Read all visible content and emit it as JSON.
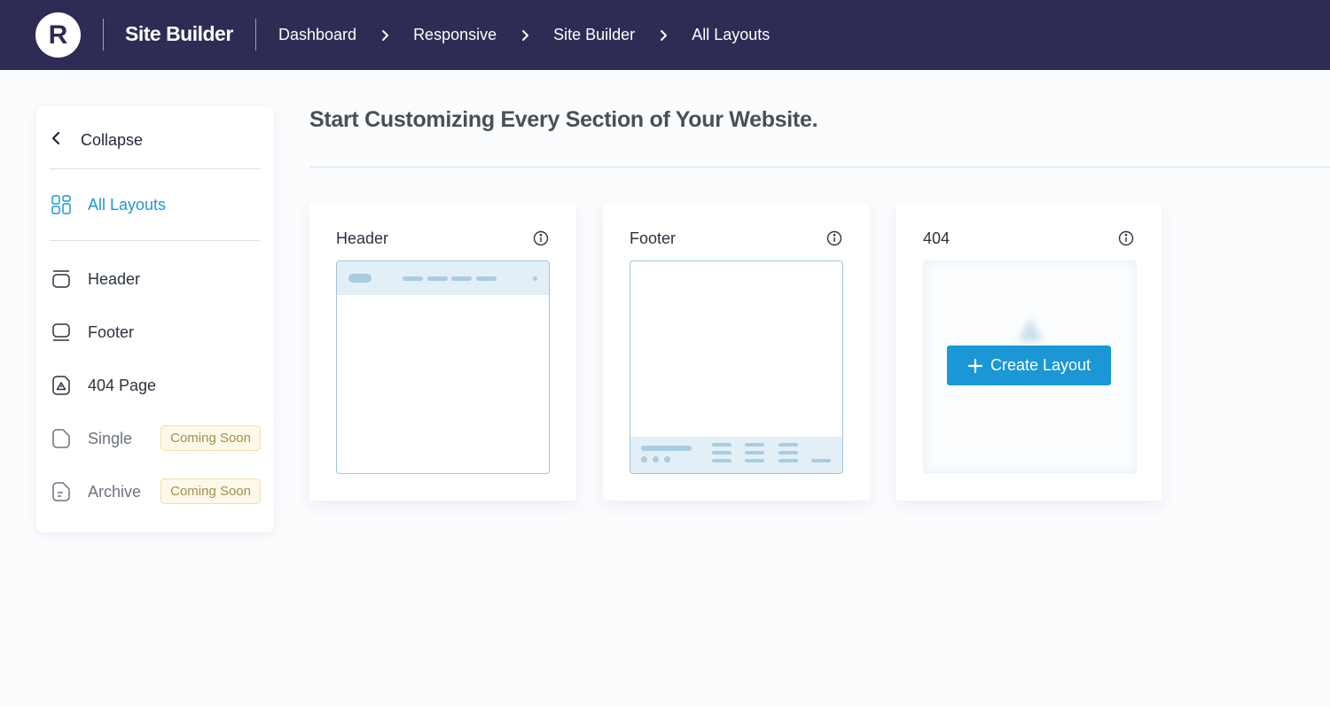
{
  "topbar": {
    "logo_letter": "R",
    "brand": "Site Builder",
    "breadcrumbs": [
      "Dashboard",
      "Responsive",
      "Site Builder",
      "All Layouts"
    ]
  },
  "sidebar": {
    "collapse_label": "Collapse",
    "items": [
      {
        "label": "All Layouts",
        "icon": "grid-icon",
        "active": true
      },
      {
        "label": "Header",
        "icon": "header-layout-icon"
      },
      {
        "label": "Footer",
        "icon": "footer-layout-icon"
      },
      {
        "label": "404 Page",
        "icon": "warning-page-icon"
      },
      {
        "label": "Single",
        "icon": "single-page-icon",
        "badge": "Coming Soon"
      },
      {
        "label": "Archive",
        "icon": "archive-page-icon",
        "badge": "Coming Soon"
      }
    ]
  },
  "main": {
    "title": "Start Customizing Every Section of Your Website.",
    "cards": [
      {
        "title": "Header"
      },
      {
        "title": "Footer"
      },
      {
        "title": "404",
        "button_label": "Create Layout"
      }
    ]
  },
  "colors": {
    "topbar_bg": "#2e2c55",
    "accent": "#1a97d4",
    "badge_text": "#a38f4a",
    "badge_bg": "#fdf9ea"
  }
}
